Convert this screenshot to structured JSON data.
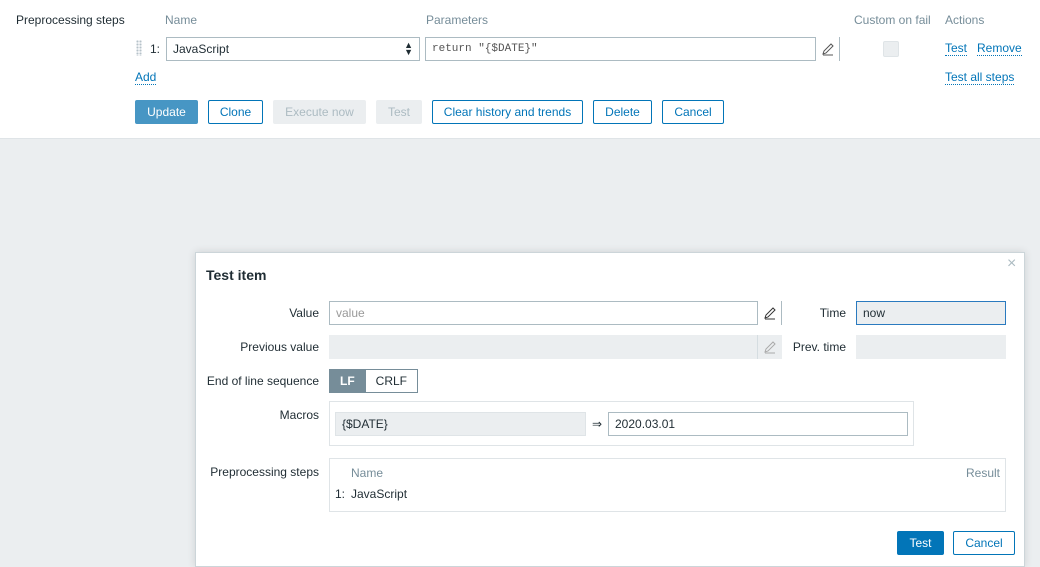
{
  "preprocessing": {
    "section_label": "Preprocessing steps",
    "headers": {
      "name": "Name",
      "parameters": "Parameters",
      "custom_on_fail": "Custom on fail",
      "actions": "Actions"
    },
    "step": {
      "index": "1:",
      "name": "JavaScript",
      "parameter": "return \"{$DATE}\""
    },
    "actions": {
      "test": "Test",
      "remove": "Remove"
    },
    "add_label": "Add",
    "test_all_label": "Test all steps"
  },
  "buttons": {
    "update": "Update",
    "clone": "Clone",
    "execute_now": "Execute now",
    "test": "Test",
    "clear_history": "Clear history and trends",
    "delete": "Delete",
    "cancel": "Cancel"
  },
  "dialog": {
    "title": "Test item",
    "close_icon": "×",
    "value_label": "Value",
    "value_placeholder": "value",
    "time_label": "Time",
    "time_value": "now",
    "previous_value_label": "Previous value",
    "prev_time_label": "Prev. time",
    "eol_label": "End of line sequence",
    "eol_options": [
      "LF",
      "CRLF"
    ],
    "eol_selected": "LF",
    "macros_label": "Macros",
    "macro": {
      "name": "{$DATE}",
      "arrow": "⇒",
      "value": "2020.03.01"
    },
    "steps_label": "Preprocessing steps",
    "steps_headers": {
      "name": "Name",
      "result": "Result"
    },
    "steps": [
      {
        "index": "1:",
        "name": "JavaScript"
      }
    ],
    "test_button": "Test",
    "cancel_button": "Cancel"
  },
  "icons": {
    "edit": "pencil-icon",
    "select": "select-arrows-icon",
    "close": "close-icon",
    "drag": "drag-handle-icon"
  }
}
